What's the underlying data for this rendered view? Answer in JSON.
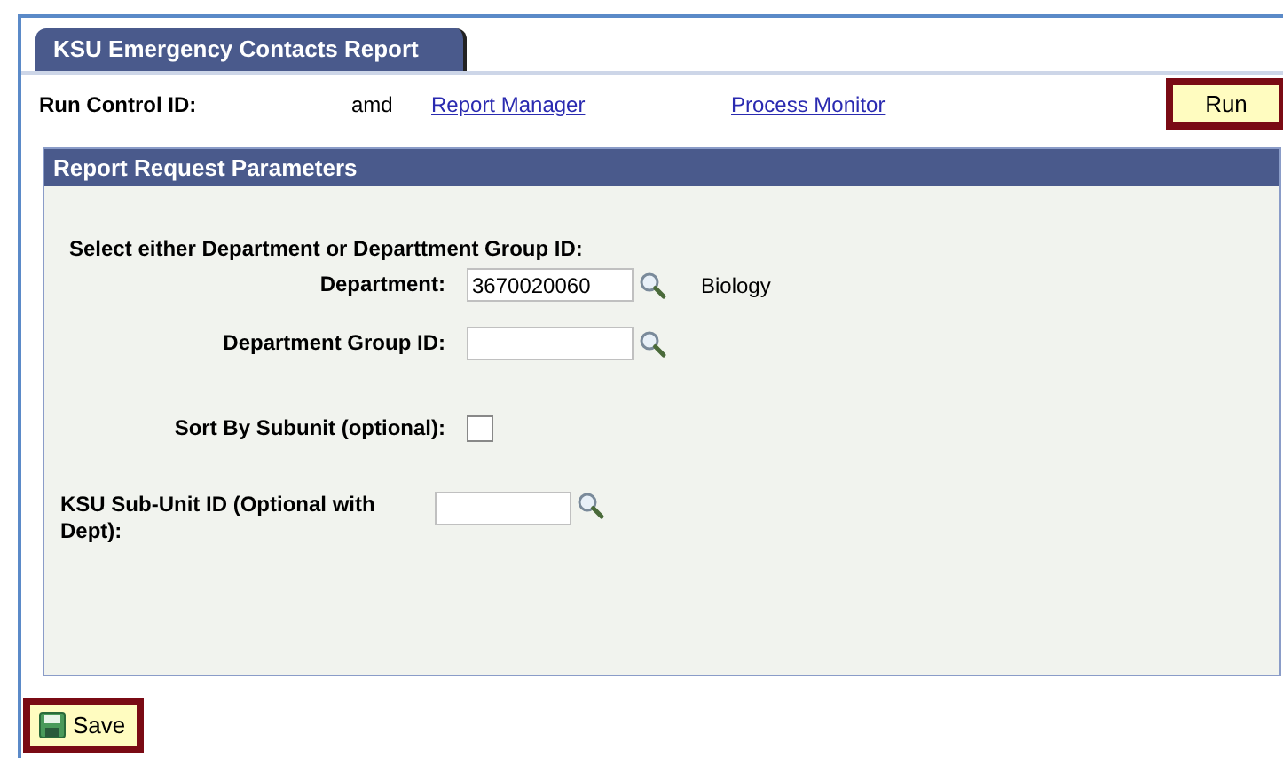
{
  "tab": {
    "label": "KSU Emergency Contacts Report",
    "selected": true
  },
  "run_control": {
    "label": "Run Control ID:",
    "value": "amd"
  },
  "links": [
    "Report Manager",
    "Process Monitor"
  ],
  "run_button": "Run",
  "panel": {
    "title": "Report Request Parameters",
    "instruction": "Select either Department or Departtment Group ID:",
    "fields": [
      {
        "kind": "lookup",
        "label": "Department:",
        "value": "3670020060",
        "description": "Biology"
      },
      {
        "kind": "lookup",
        "label": "Department Group ID:"
      },
      {
        "kind": "checkbox",
        "label": "Sort By Subunit (optional):",
        "checked": false
      },
      {
        "kind": "lookup-wide",
        "label": "KSU Sub-Unit ID (Optional with Dept):"
      }
    ]
  },
  "save_button": "Save"
}
